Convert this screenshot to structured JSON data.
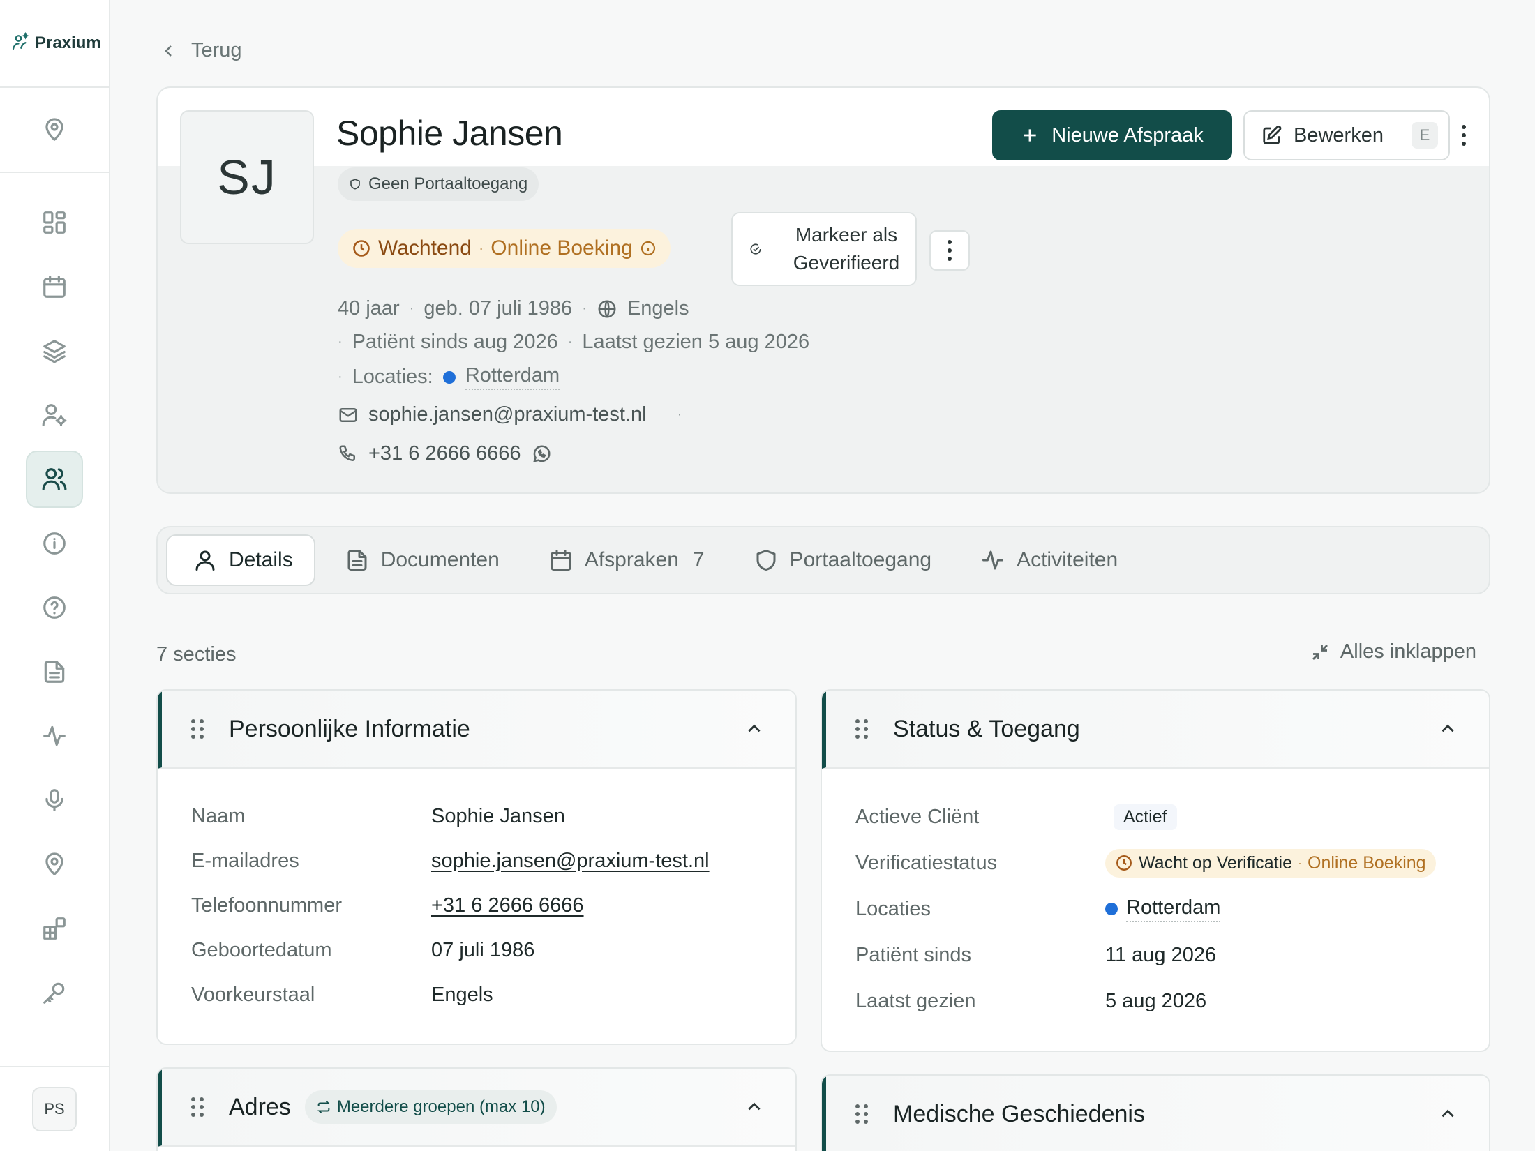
{
  "app": {
    "brand": "Praxium",
    "user_initials": "PS"
  },
  "sidebar": {
    "icons": [
      "location-pin-icon",
      "dashboard-grid-icon",
      "calendar-icon",
      "layers-icon",
      "user-settings-icon",
      "users-icon",
      "info-icon",
      "help-icon",
      "document-icon",
      "activity-icon",
      "microphone-icon",
      "location-pin-icon",
      "widgets-icon",
      "key-icon"
    ],
    "active": "users-icon"
  },
  "header": {
    "back_label": "Terug"
  },
  "patient": {
    "initials": "SJ",
    "name": "Sophie Jansen",
    "portal_badge": "Geen Portaaltoegang",
    "status_label": "Wachtend",
    "status_sub": "Online Boeking",
    "verify_button": "Markeer als Geverifieerd",
    "age": "40 jaar",
    "birth": "geb. 07 juli 1986",
    "language": "Engels",
    "patient_since": "Patiënt sinds aug 2026",
    "last_seen": "Laatst gezien 5 aug 2026",
    "locations_label": "Locaties:",
    "location": "Rotterdam",
    "email": "sophie.jansen@praxium-test.nl",
    "phone": "+31 6 2666 6666"
  },
  "actions": {
    "new_appointment": "Nieuwe Afspraak",
    "edit": "Bewerken",
    "edit_shortcut": "E"
  },
  "tabs": [
    {
      "label": "Details",
      "active": true
    },
    {
      "label": "Documenten"
    },
    {
      "label": "Afspraken",
      "count": "7"
    },
    {
      "label": "Portaaltoegang"
    },
    {
      "label": "Activiteiten"
    }
  ],
  "sections_header": {
    "count_label": "7 secties",
    "collapse_all": "Alles inklappen"
  },
  "personal": {
    "title": "Persoonlijke Informatie",
    "rows": [
      {
        "label": "Naam",
        "value": "Sophie Jansen"
      },
      {
        "label": "E-mailadres",
        "value": "sophie.jansen@praxium-test.nl"
      },
      {
        "label": "Telefoonnummer",
        "value": "+31 6 2666 6666"
      },
      {
        "label": "Geboortedatum",
        "value": "07 juli 1986"
      },
      {
        "label": "Voorkeurstaal",
        "value": "Engels"
      }
    ]
  },
  "status": {
    "title": "Status & Toegang",
    "rows": [
      {
        "label": "Actieve Cliënt",
        "value": "Actief"
      },
      {
        "label": "Verificatiestatus",
        "value": "Wacht op Verificatie",
        "sub": "Online Boeking"
      },
      {
        "label": "Locaties",
        "value": "Rotterdam"
      },
      {
        "label": "Patiënt sinds",
        "value": "11 aug 2026"
      },
      {
        "label": "Laatst gezien",
        "value": "5 aug 2026"
      }
    ]
  },
  "address": {
    "title": "Adres",
    "badge": "Meerdere groepen (max 10)"
  },
  "medical": {
    "title": "Medische Geschiedenis"
  },
  "colors": {
    "primary": "#124d49",
    "location_dot": "#1f6fd8",
    "warning_bg": "#fcf2dd",
    "warning_text": "#8a4a12"
  }
}
